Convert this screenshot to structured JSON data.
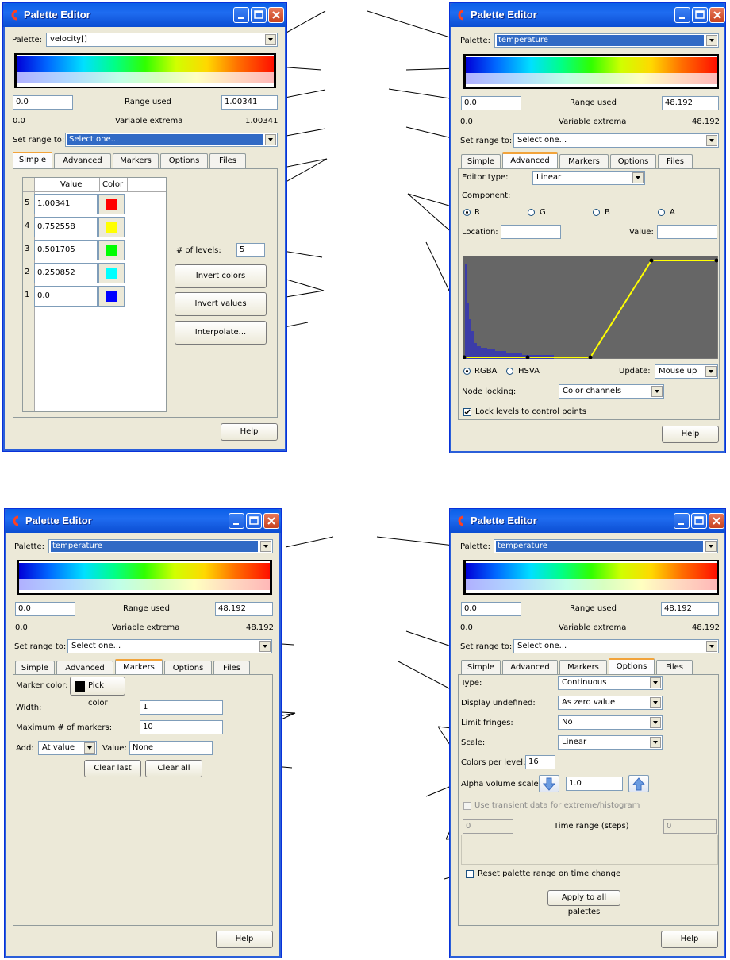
{
  "window_title": "Palette Editor",
  "labels": {
    "palette": "Palette:",
    "range_used": "Range used",
    "variable_extrema": "Variable extrema",
    "set_range_to": "Set range to:",
    "help": "Help"
  },
  "tabs": [
    "Simple",
    "Advanced",
    "Markers",
    "Options",
    "Files"
  ],
  "w1": {
    "palette_value": "velocity[]",
    "range_min": "0.0",
    "range_max": "1.00341",
    "extrema_min": "0.0",
    "extrema_max": "1.00341",
    "set_range_value": "Select one...",
    "table_header_value": "Value",
    "table_header_color": "Color",
    "rows": [
      {
        "index": "5",
        "value": "1.00341",
        "color": "#ff0000"
      },
      {
        "index": "4",
        "value": "0.752558",
        "color": "#ffff00"
      },
      {
        "index": "3",
        "value": "0.501705",
        "color": "#00ff00"
      },
      {
        "index": "2",
        "value": "0.250852",
        "color": "#00ffff"
      },
      {
        "index": "1",
        "value": "0.0",
        "color": "#0000ff"
      }
    ],
    "levels_label": "# of levels:",
    "levels_value": "5",
    "invert_colors": "Invert colors",
    "invert_values": "Invert values",
    "interpolate": "Interpolate..."
  },
  "w2": {
    "palette_value": "temperature",
    "range_min": "0.0",
    "range_max": "48.192",
    "extrema_min": "0.0",
    "extrema_max": "48.192",
    "set_range_value": "Select one...",
    "editor_type_label": "Editor type:",
    "editor_type_value": "Linear",
    "component_label": "Component:",
    "components": [
      "R",
      "G",
      "B",
      "A"
    ],
    "location_label": "Location:",
    "value_label": "Value:",
    "rgba": "RGBA",
    "hsva": "HSVA",
    "update_label": "Update:",
    "update_value": "Mouse up",
    "node_locking_label": "Node locking:",
    "node_locking_value": "Color channels",
    "lock_levels": "Lock levels to control points",
    "graph_bg": "#666666",
    "curve_color": "#ffff00",
    "histogram_color": "#3c3ca8"
  },
  "w3": {
    "palette_value": "temperature",
    "range_min": "0.0",
    "range_max": "48.192",
    "extrema_min": "0.0",
    "extrema_max": "48.192",
    "set_range_value": "Select one...",
    "marker_color_label": "Marker color:",
    "pick_color": "Pick color",
    "width_label": "Width:",
    "width_value": "1",
    "max_markers_label": "Maximum # of markers:",
    "max_markers_value": "10",
    "add_label": "Add:",
    "add_value": "At value",
    "value_label": "Value:",
    "value_value": "None",
    "clear_last": "Clear last",
    "clear_all": "Clear all"
  },
  "w4": {
    "palette_value": "temperature",
    "range_min": "0.0",
    "range_max": "48.192",
    "extrema_min": "0.0",
    "extrema_max": "48.192",
    "set_range_value": "Select one...",
    "type_label": "Type:",
    "type_value": "Continuous",
    "display_undefined_label": "Display undefined:",
    "display_undefined_value": "As zero value",
    "limit_fringes_label": "Limit fringes:",
    "limit_fringes_value": "No",
    "scale_label": "Scale:",
    "scale_value": "Linear",
    "colors_per_level_label": "Colors per level:",
    "colors_per_level_value": "16",
    "alpha_label": "Alpha volume scale:",
    "alpha_value": "1.0",
    "transient_label": "Use transient data for extreme/histogram",
    "time_start": "0",
    "time_range_label": "Time range (steps)",
    "time_end": "0",
    "reset_label": "Reset palette range on time change",
    "apply_all": "Apply to all palettes"
  }
}
